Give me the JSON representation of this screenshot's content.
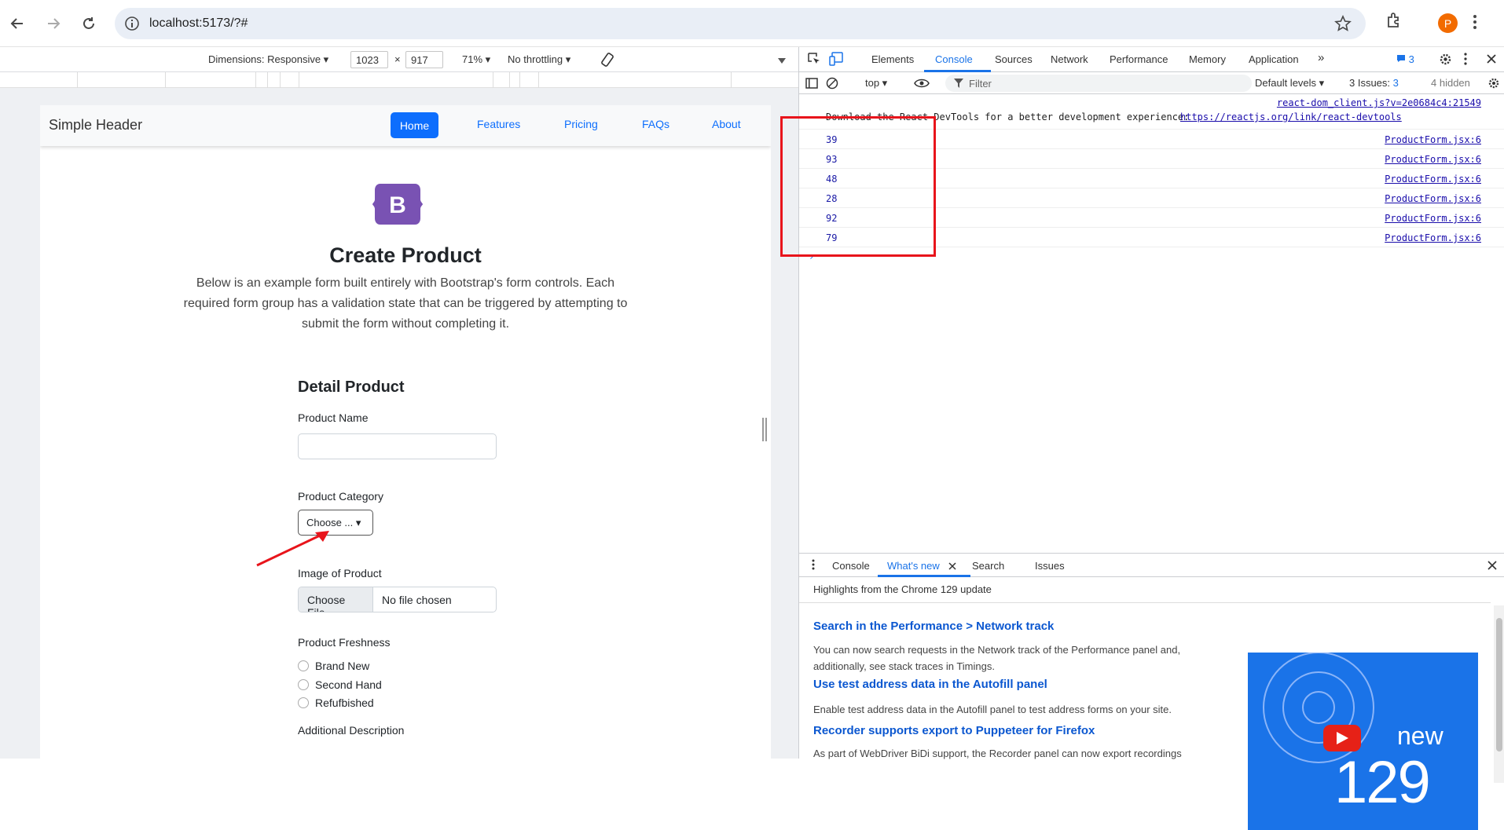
{
  "browser": {
    "url": "localhost:5173/?#",
    "avatar_letter": "P"
  },
  "emulation": {
    "dimensions": "Dimensions: Responsive ▾",
    "width": "1023",
    "times": "×",
    "height": "917",
    "zoom": "71% ▾",
    "throttling": "No throttling ▾"
  },
  "site": {
    "brand": "Simple Header",
    "nav": [
      "Home",
      "Features",
      "Pricing",
      "FAQs",
      "About"
    ],
    "logo_letter": "B",
    "title": "Create Product",
    "lead": "Below is an example form built entirely with Bootstrap's form controls. Each required form group has a validation state that can be triggered by attempting to submit the form without completing it.",
    "form": {
      "heading": "Detail Product",
      "name_label": "Product Name",
      "category_label": "Product Category",
      "category_value": "Choose ... ▾",
      "image_label": "Image of Product",
      "file_button": "Choose File",
      "file_status": "No file chosen",
      "freshness_label": "Product Freshness",
      "freshness_options": [
        "Brand New",
        "Second Hand",
        "Refufbished"
      ],
      "description_label": "Additional Description"
    }
  },
  "devtools": {
    "tabs": [
      "Elements",
      "Console",
      "Sources",
      "Network",
      "Performance",
      "Memory",
      "Application"
    ],
    "active_tab": "Console",
    "issue_count_badge": "3",
    "context": "top ▾",
    "filter_placeholder": "Filter",
    "levels": "Default levels ▾",
    "issues": "3 Issues: ",
    "issues_count": "3",
    "hidden": "4 hidden",
    "console_lines": [
      {
        "value": "39",
        "source": "ProductForm.jsx:6"
      },
      {
        "value": "93",
        "source": "ProductForm.jsx:6"
      },
      {
        "value": "48",
        "source": "ProductForm.jsx:6"
      },
      {
        "value": "28",
        "source": "ProductForm.jsx:6"
      },
      {
        "value": "92",
        "source": "ProductForm.jsx:6"
      },
      {
        "value": "79",
        "source": "ProductForm.jsx:6"
      }
    ],
    "react_source": "react-dom_client.js?v=2e0684c4:21549",
    "react_msg": "Download the React DevTools for a better development experience: ",
    "react_link": "https://reactjs.org/link/react-devtools",
    "drawer_tabs": [
      "Console",
      "What's new",
      "Search",
      "Issues"
    ],
    "drawer_active": "What's new",
    "whatsnew": {
      "highlight": "Highlights from the Chrome 129 update",
      "features": [
        {
          "title": "Search in the Performance > Network track",
          "desc": "You can now search requests in the Network track of the Performance panel and, additionally, see stack traces in Timings."
        },
        {
          "title": "Use test address data in the Autofill panel",
          "desc": "Enable test address data in the Autofill panel to test address forms on your site."
        },
        {
          "title": "Recorder supports export to Puppeteer for Firefox",
          "desc": "As part of WebDriver BiDi support, the Recorder panel can now export recordings"
        }
      ],
      "promo_new": "new",
      "promo_version": "129"
    }
  },
  "colors": {
    "accent": "#0d6efd",
    "devtools_blue": "#1a73e8",
    "annotation_red": "#e8141b",
    "bootstrap_purple": "#7952b3"
  }
}
